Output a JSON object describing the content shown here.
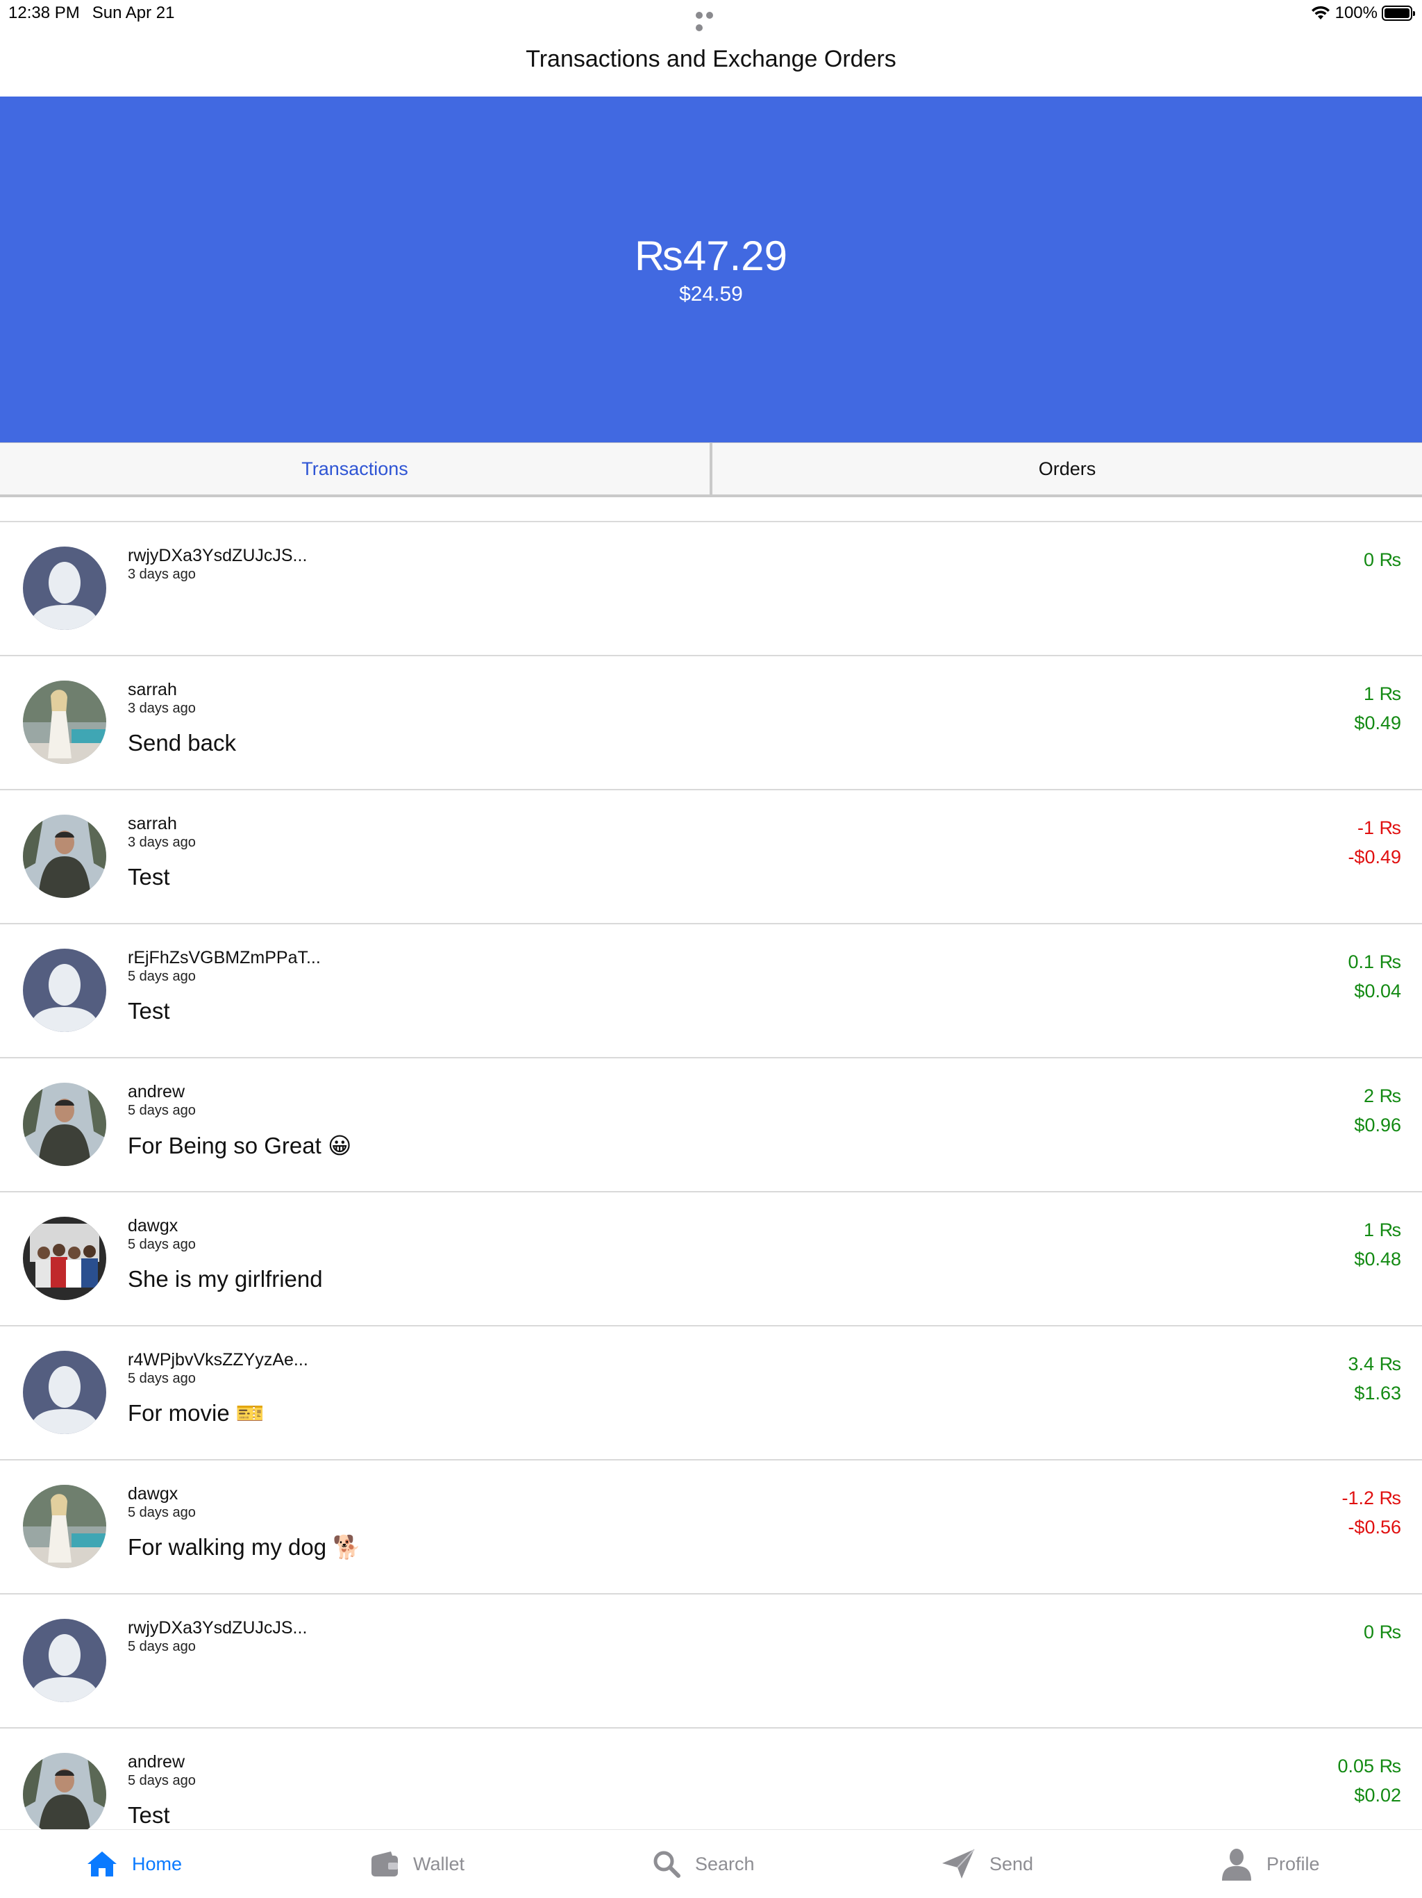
{
  "status": {
    "time": "12:38 PM",
    "date": "Sun Apr 21",
    "battery": "100%"
  },
  "nav": {
    "title": "Transactions and Exchange Orders"
  },
  "balance": {
    "primary": "₨47.29",
    "secondary": "$24.59"
  },
  "tabs": [
    {
      "label": "Transactions",
      "active": true
    },
    {
      "label": "Orders",
      "active": false
    }
  ],
  "transactions": [
    {
      "name": "rwjyDXa3YsdZUJcJS...",
      "time": "3 days ago",
      "memo": "",
      "amount": "0 ₨",
      "usd": "",
      "direction": "in",
      "avatar": "default-avatar"
    },
    {
      "name": "sarrah",
      "time": "3 days ago",
      "memo": "Send back",
      "amount": "1 ₨",
      "usd": "$0.49",
      "direction": "in",
      "avatar": "photo-woman"
    },
    {
      "name": "sarrah",
      "time": "3 days ago",
      "memo": "Test",
      "amount": "-1 ₨",
      "usd": "-$0.49",
      "direction": "out",
      "avatar": "photo-man"
    },
    {
      "name": "rEjFhZsVGBMZmPPaT...",
      "time": "5 days ago",
      "memo": "Test",
      "amount": "0.1 ₨",
      "usd": "$0.04",
      "direction": "in",
      "avatar": "default-avatar"
    },
    {
      "name": "andrew",
      "time": "5 days ago",
      "memo": "For Being so Great 😀",
      "amount": "2 ₨",
      "usd": "$0.96",
      "direction": "in",
      "avatar": "photo-man"
    },
    {
      "name": "dawgx",
      "time": "5 days ago",
      "memo": "She is my girlfriend",
      "amount": "1 ₨",
      "usd": "$0.48",
      "direction": "in",
      "avatar": "photo-group"
    },
    {
      "name": "r4WPjbvVksZZYyzAe...",
      "time": "5 days ago",
      "memo": "For movie 🎫",
      "amount": "3.4 ₨",
      "usd": "$1.63",
      "direction": "in",
      "avatar": "default-avatar"
    },
    {
      "name": "dawgx",
      "time": "5 days ago",
      "memo": "For walking my dog 🐕",
      "amount": "-1.2 ₨",
      "usd": "-$0.56",
      "direction": "out",
      "avatar": "photo-woman"
    },
    {
      "name": "rwjyDXa3YsdZUJcJS...",
      "time": "5 days ago",
      "memo": "",
      "amount": "0 ₨",
      "usd": "",
      "direction": "in",
      "avatar": "default-avatar"
    },
    {
      "name": "andrew",
      "time": "5 days ago",
      "memo": "Test",
      "amount": "0.05 ₨",
      "usd": "$0.02",
      "direction": "in",
      "avatar": "photo-man"
    }
  ],
  "tabbar": [
    {
      "label": "Home",
      "icon": "home-icon",
      "active": true
    },
    {
      "label": "Wallet",
      "icon": "wallet-icon",
      "active": false
    },
    {
      "label": "Search",
      "icon": "search-icon",
      "active": false
    },
    {
      "label": "Send",
      "icon": "send-icon",
      "active": false
    },
    {
      "label": "Profile",
      "icon": "profile-icon",
      "active": false
    }
  ],
  "colors": {
    "banner": "#4169e1",
    "positive": "#138a13",
    "negative": "#e01010",
    "tab_active": "#0a7aff"
  }
}
